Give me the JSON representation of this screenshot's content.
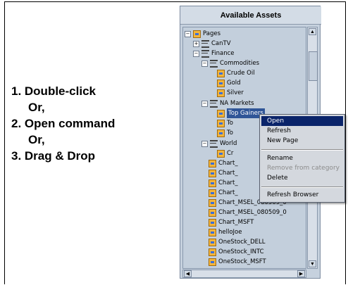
{
  "instructions": {
    "line1": "1. Double-click",
    "or1": "Or,",
    "line2": "2. Open command",
    "or2": "Or,",
    "line3": "3. Drag & Drop"
  },
  "panel": {
    "title": "Available Assets"
  },
  "tree": {
    "pages": "Pages",
    "cantv": "CanTV",
    "finance": "Finance",
    "commodities": "Commodities",
    "crude_oil": "Crude Oil",
    "gold": "Gold",
    "silver": "Silver",
    "na_markets": "NA Markets",
    "top_gainers": "Top Gainers",
    "to1": "To",
    "to2": "To",
    "world": "World",
    "cr": "Cr",
    "chart1": "Chart_",
    "chart2": "Chart_",
    "chart3": "Chart_",
    "chart4": "Chart_",
    "chart_msel1": "Chart_MSEL_080509_0",
    "chart_msel2": "Chart_MSEL_080509_0",
    "chart_msft": "Chart_MSFT",
    "hellojoe": "helloJoe",
    "onestock_dell": "OneStock_DELL",
    "onestock_intc": "OneStock_INTC",
    "onestock_msft": "OneStock_MSFT"
  },
  "context_menu": {
    "open": "Open",
    "refresh": "Refresh",
    "new_page": "New Page",
    "rename": "Rename",
    "remove": "Remove from category",
    "delete": "Delete",
    "refresh_browser": "Refresh Browser"
  },
  "colors": {
    "panel_bg": "#c6d1de",
    "selection": "#0a246a"
  }
}
